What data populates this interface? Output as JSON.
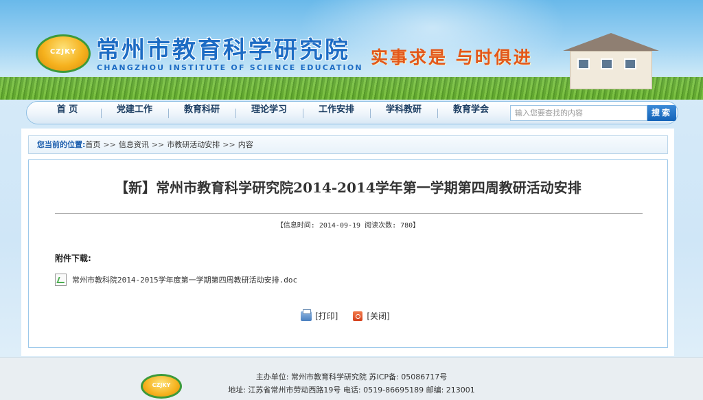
{
  "header": {
    "logo_text": "CZJKY",
    "title": "常州市教育科学研究院",
    "subtitle": "CHANGZHOU INSTITUTE OF SCIENCE EDUCATION",
    "slogan": "实事求是  与时俱进"
  },
  "nav": {
    "items": [
      {
        "label": "首 页"
      },
      {
        "label": "党建工作"
      },
      {
        "label": "教育科研"
      },
      {
        "label": "理论学习"
      },
      {
        "label": "工作安排"
      },
      {
        "label": "学科教研"
      },
      {
        "label": "教育学会"
      }
    ],
    "search_placeholder": "输入您要查找的内容",
    "search_button": "搜索"
  },
  "breadcrumb": {
    "label": "您当前的位置:",
    "items": [
      "首页",
      "信息资讯",
      "市教研活动安排",
      "内容"
    ],
    "separator": ">>"
  },
  "article": {
    "title": "【新】常州市教育科学研究院2014-2014学年第一学期第四周教研活动安排",
    "meta": "【信息时间: 2014-09-19  阅读次数: 780】",
    "attachment_label": "附件下载:",
    "attachment_name": "常州市教科院2014-2015学年度第一学期第四周教研活动安排.doc",
    "print_label": "[打印]",
    "close_label": "[关闭]"
  },
  "footer": {
    "logo_text": "CZJKY",
    "line1": "主办单位: 常州市教育科学研究院   苏ICP备: 05086717号",
    "line2": "地址: 江苏省常州市劳动西路19号   电话: 0519-86695189   邮编: 213001"
  },
  "colors": {
    "brand_blue": "#1d6cc4",
    "slogan_orange": "#e2571a",
    "logo_green": "#3d9a3a"
  }
}
